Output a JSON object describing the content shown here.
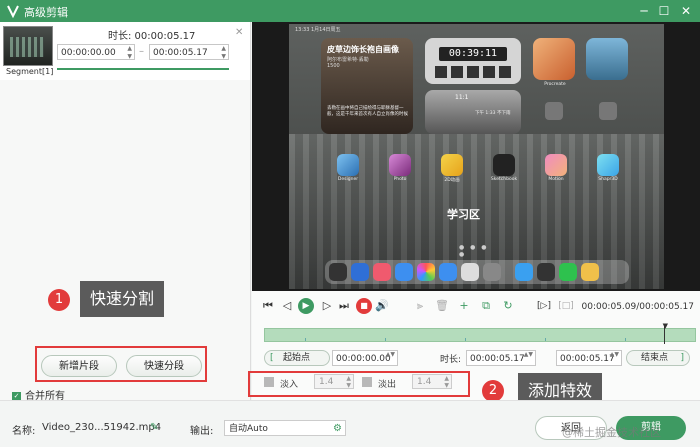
{
  "window": {
    "title": "高级剪辑",
    "minimize": "─",
    "maximize": "☐",
    "close": "✕"
  },
  "segment": {
    "label": "Segment[1]",
    "duration": "时长: 00:00:05.17",
    "start": "00:00:00.00",
    "end": "00:00:05.17",
    "close": "✕",
    "dash": "–"
  },
  "left_buttons": {
    "add_segment": "新增片段",
    "quick_split": "快速分段"
  },
  "merge_all": {
    "label": "合并所有",
    "checked": true
  },
  "callouts": [
    {
      "number": "1",
      "text": "快速分割"
    },
    {
      "number": "2",
      "text": "添加特效"
    }
  ],
  "video_frame": {
    "status_bar": "13:33 1月14日周五",
    "widget_title": "皮草边饰长袍自画像",
    "widget_sub1": "阿尔布雷希特·丢勒",
    "widget_sub2": "1500",
    "widget_caption": "丢勒在画中将自己描绘得与耶稣基督一般，这是千年来首次有人自立肖像的时候",
    "clock_time": "00:39:11",
    "dial_label": "11:1",
    "dial_text": "下午 1:33 不下雨",
    "procreate_label": "Procreate",
    "watermark_text": "学习区",
    "page_dots": "● ● ● ●",
    "apps": [
      "Designer",
      "Photo",
      "2D动画",
      "Sketchbook",
      "Motion",
      "Shapr3D"
    ]
  },
  "player": {
    "time": "00:00:05.09/00:00:05.17",
    "icons": {
      "prev": "⏮",
      "step_back": "◁",
      "play": "▶",
      "step_fwd": "▷",
      "next": "⏭",
      "stop": "■",
      "volume": "🔊",
      "delete": "🗑",
      "add": "+",
      "copy": "⧉",
      "rotate": "↻",
      "frame1": "[▷]",
      "frame2": "[□]",
      "head": "▼"
    }
  },
  "range": {
    "start_btn": "起始点",
    "start_time": "00:00:00.00",
    "duration_label": "时长:",
    "duration": "00:00:05.17",
    "end_time": "00:00:05.17",
    "end_btn": "结束点",
    "lbracket": "[",
    "rbracket": "]",
    "spin": "▲▼"
  },
  "effects": {
    "fade_in": "淡入",
    "fade_in_value": "1.4",
    "fade_out": "淡出",
    "fade_out_value": "1.4"
  },
  "bottom": {
    "name_label": "名称:",
    "name_value": "Video_230...51942.mp4",
    "edit_icon": "✎",
    "output_label": "输出:",
    "output_value": "自动Auto",
    "gear_icon": "⚙",
    "back": "返回",
    "cut": "剪辑"
  },
  "watermark": "@稀土掘金技术社区",
  "colors": {
    "accent": "#3e9a62",
    "highlight": "#e23b3b"
  }
}
